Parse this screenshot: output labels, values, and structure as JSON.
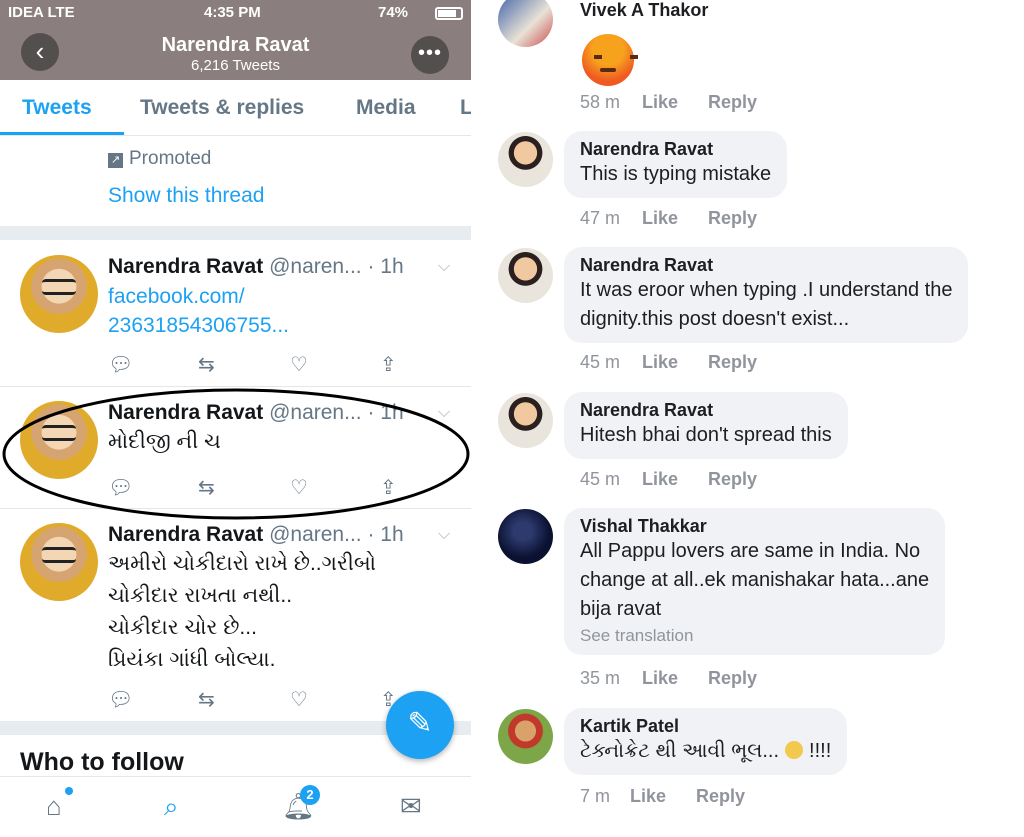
{
  "twitter": {
    "status_bar": {
      "carrier": "IDEA  LTE",
      "time": "4:35 PM",
      "battery": "74%"
    },
    "header": {
      "name": "Narendra Ravat",
      "tweet_count": "6,216 Tweets",
      "more": "•••",
      "back": "‹"
    },
    "tabs": [
      "Tweets",
      "Tweets & replies",
      "Media",
      "L"
    ],
    "promoted": {
      "label": "Promoted",
      "show_thread": "Show this thread"
    },
    "tweets": [
      {
        "name": "Narendra Ravat",
        "handle": "@naren... · 1h",
        "lines": [
          "facebook.com/",
          "23631854306755..."
        ]
      },
      {
        "name": "Narendra Ravat",
        "handle": "@naren... · 1h",
        "lines": [
          "મોદીજી ની ચ"
        ]
      },
      {
        "name": "Narendra Ravat",
        "handle": "@naren... · 1h",
        "lines": [
          "અમીરો ચોકીદારો રાખે છે..ગરીબો",
          "ચોકીદાર રાખતા નથી..",
          "ચોકીદાર ચોર છે...",
          "પ્રિયંકા ગાંધી બોલ્યા."
        ]
      }
    ],
    "who_to_follow": "Who to follow",
    "notification_count": "2",
    "icons": {
      "reply": "reply-icon",
      "retweet": "retweet-icon",
      "like": "heart-icon",
      "share": "share-icon",
      "compose": "compose-icon",
      "home": "home-icon",
      "search": "search-icon",
      "notifications": "bell-icon",
      "messages": "mail-icon"
    },
    "accent": "#1da1f2"
  },
  "facebook": {
    "comments": [
      {
        "name": "Vivek A Thakor",
        "text": [],
        "time": "58 m",
        "like": "Like",
        "reply": "Reply"
      },
      {
        "name": "Narendra Ravat",
        "text": [
          "This is typing mistake"
        ],
        "time": "47 m",
        "like": "Like",
        "reply": "Reply"
      },
      {
        "name": "Narendra Ravat",
        "text": [
          "It was eroor when typing .I understand the",
          "dignity.this post doesn't exist..."
        ],
        "time": "45 m",
        "like": "Like",
        "reply": "Reply"
      },
      {
        "name": "Narendra Ravat",
        "text": [
          "Hitesh bhai don't spread this"
        ],
        "time": "45 m",
        "like": "Like",
        "reply": "Reply"
      },
      {
        "name": "Vishal Thakkar",
        "text": [
          "All Pappu lovers are same in India. No",
          "change at all..ek manishakar hata...ane",
          "bija ravat"
        ],
        "see_translation": "See translation",
        "time": "35 m",
        "like": "Like",
        "reply": "Reply"
      },
      {
        "name": "Kartik Patel",
        "text": [
          "ટેક્નોક્રેટ થી આવી ભૂલ...",
          "!!!!"
        ],
        "time": "7 m",
        "like": "Like",
        "reply": "Reply"
      }
    ]
  }
}
